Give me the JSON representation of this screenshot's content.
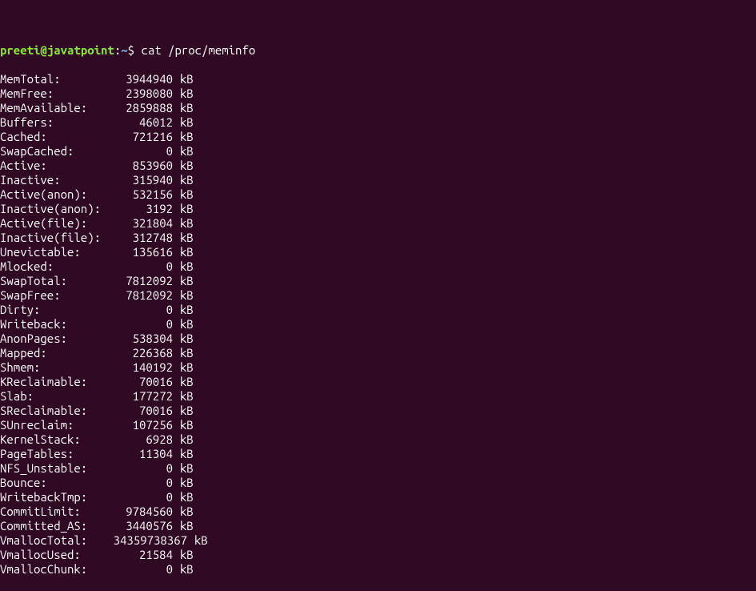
{
  "top_line_fragment": "                                                                           ",
  "prompt": {
    "user": "preeti",
    "at": "@",
    "host": "javatpoint",
    "colon": ":",
    "path": "~",
    "dollar": "$ "
  },
  "command": "cat /proc/meminfo",
  "meminfo": [
    {
      "label": "MemTotal:",
      "value": "3944940",
      "unit": "kB"
    },
    {
      "label": "MemFree:",
      "value": "2398080",
      "unit": "kB"
    },
    {
      "label": "MemAvailable:",
      "value": "2859888",
      "unit": "kB"
    },
    {
      "label": "Buffers:",
      "value": "46012",
      "unit": "kB"
    },
    {
      "label": "Cached:",
      "value": "721216",
      "unit": "kB"
    },
    {
      "label": "SwapCached:",
      "value": "0",
      "unit": "kB"
    },
    {
      "label": "Active:",
      "value": "853960",
      "unit": "kB"
    },
    {
      "label": "Inactive:",
      "value": "315940",
      "unit": "kB"
    },
    {
      "label": "Active(anon):",
      "value": "532156",
      "unit": "kB"
    },
    {
      "label": "Inactive(anon):",
      "value": "3192",
      "unit": "kB"
    },
    {
      "label": "Active(file):",
      "value": "321804",
      "unit": "kB"
    },
    {
      "label": "Inactive(file):",
      "value": "312748",
      "unit": "kB"
    },
    {
      "label": "Unevictable:",
      "value": "135616",
      "unit": "kB"
    },
    {
      "label": "Mlocked:",
      "value": "0",
      "unit": "kB"
    },
    {
      "label": "SwapTotal:",
      "value": "7812092",
      "unit": "kB"
    },
    {
      "label": "SwapFree:",
      "value": "7812092",
      "unit": "kB"
    },
    {
      "label": "Dirty:",
      "value": "0",
      "unit": "kB"
    },
    {
      "label": "Writeback:",
      "value": "0",
      "unit": "kB"
    },
    {
      "label": "AnonPages:",
      "value": "538304",
      "unit": "kB"
    },
    {
      "label": "Mapped:",
      "value": "226368",
      "unit": "kB"
    },
    {
      "label": "Shmem:",
      "value": "140192",
      "unit": "kB"
    },
    {
      "label": "KReclaimable:",
      "value": "70016",
      "unit": "kB"
    },
    {
      "label": "Slab:",
      "value": "177272",
      "unit": "kB"
    },
    {
      "label": "SReclaimable:",
      "value": "70016",
      "unit": "kB"
    },
    {
      "label": "SUnreclaim:",
      "value": "107256",
      "unit": "kB"
    },
    {
      "label": "KernelStack:",
      "value": "6928",
      "unit": "kB"
    },
    {
      "label": "PageTables:",
      "value": "11304",
      "unit": "kB"
    },
    {
      "label": "NFS_Unstable:",
      "value": "0",
      "unit": "kB"
    },
    {
      "label": "Bounce:",
      "value": "0",
      "unit": "kB"
    },
    {
      "label": "WritebackTmp:",
      "value": "0",
      "unit": "kB"
    },
    {
      "label": "CommitLimit:",
      "value": "9784560",
      "unit": "kB"
    },
    {
      "label": "Committed_AS:",
      "value": "3440576",
      "unit": "kB"
    },
    {
      "label": "VmallocTotal:",
      "value": "34359738367",
      "unit": "kB",
      "wide": true
    },
    {
      "label": "VmallocUsed:",
      "value": "21584",
      "unit": "kB"
    },
    {
      "label": "VmallocChunk:",
      "value": "0",
      "unit": "kB"
    }
  ]
}
